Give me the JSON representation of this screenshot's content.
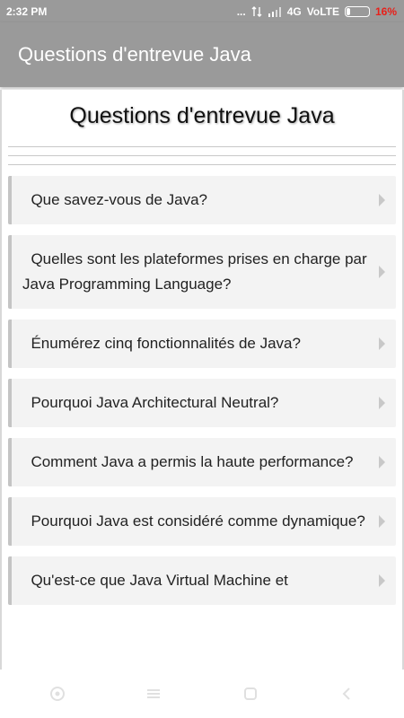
{
  "status_bar": {
    "time": "2:32 PM",
    "dots": "...",
    "network": "4G",
    "volte": "VoLTE",
    "battery_level": 0.16,
    "battery_percent": "16%",
    "battery_percent_color": "#e8201a"
  },
  "app_bar": {
    "title": "Questions d'entrevue Java",
    "color": "#9a9a9a"
  },
  "main": {
    "heading": "Questions d'entrevue Java",
    "questions": [
      {
        "text": "Que savez-vous de Java?"
      },
      {
        "text": "Quelles sont les plateformes prises en charge par Java Programming Language?"
      },
      {
        "text": "Énumérez cinq fonctionnalités de Java?"
      },
      {
        "text": "Pourquoi Java Architectural Neutral?"
      },
      {
        "text": "Comment Java a permis la haute performance?"
      },
      {
        "text": "Pourquoi Java est considéré comme dynamique?"
      },
      {
        "text": "Qu'est-ce que Java Virtual Machine et"
      }
    ]
  },
  "nav_bar": {
    "icons": [
      "home-circle-icon",
      "menu-icon",
      "square-icon",
      "back-icon"
    ]
  }
}
